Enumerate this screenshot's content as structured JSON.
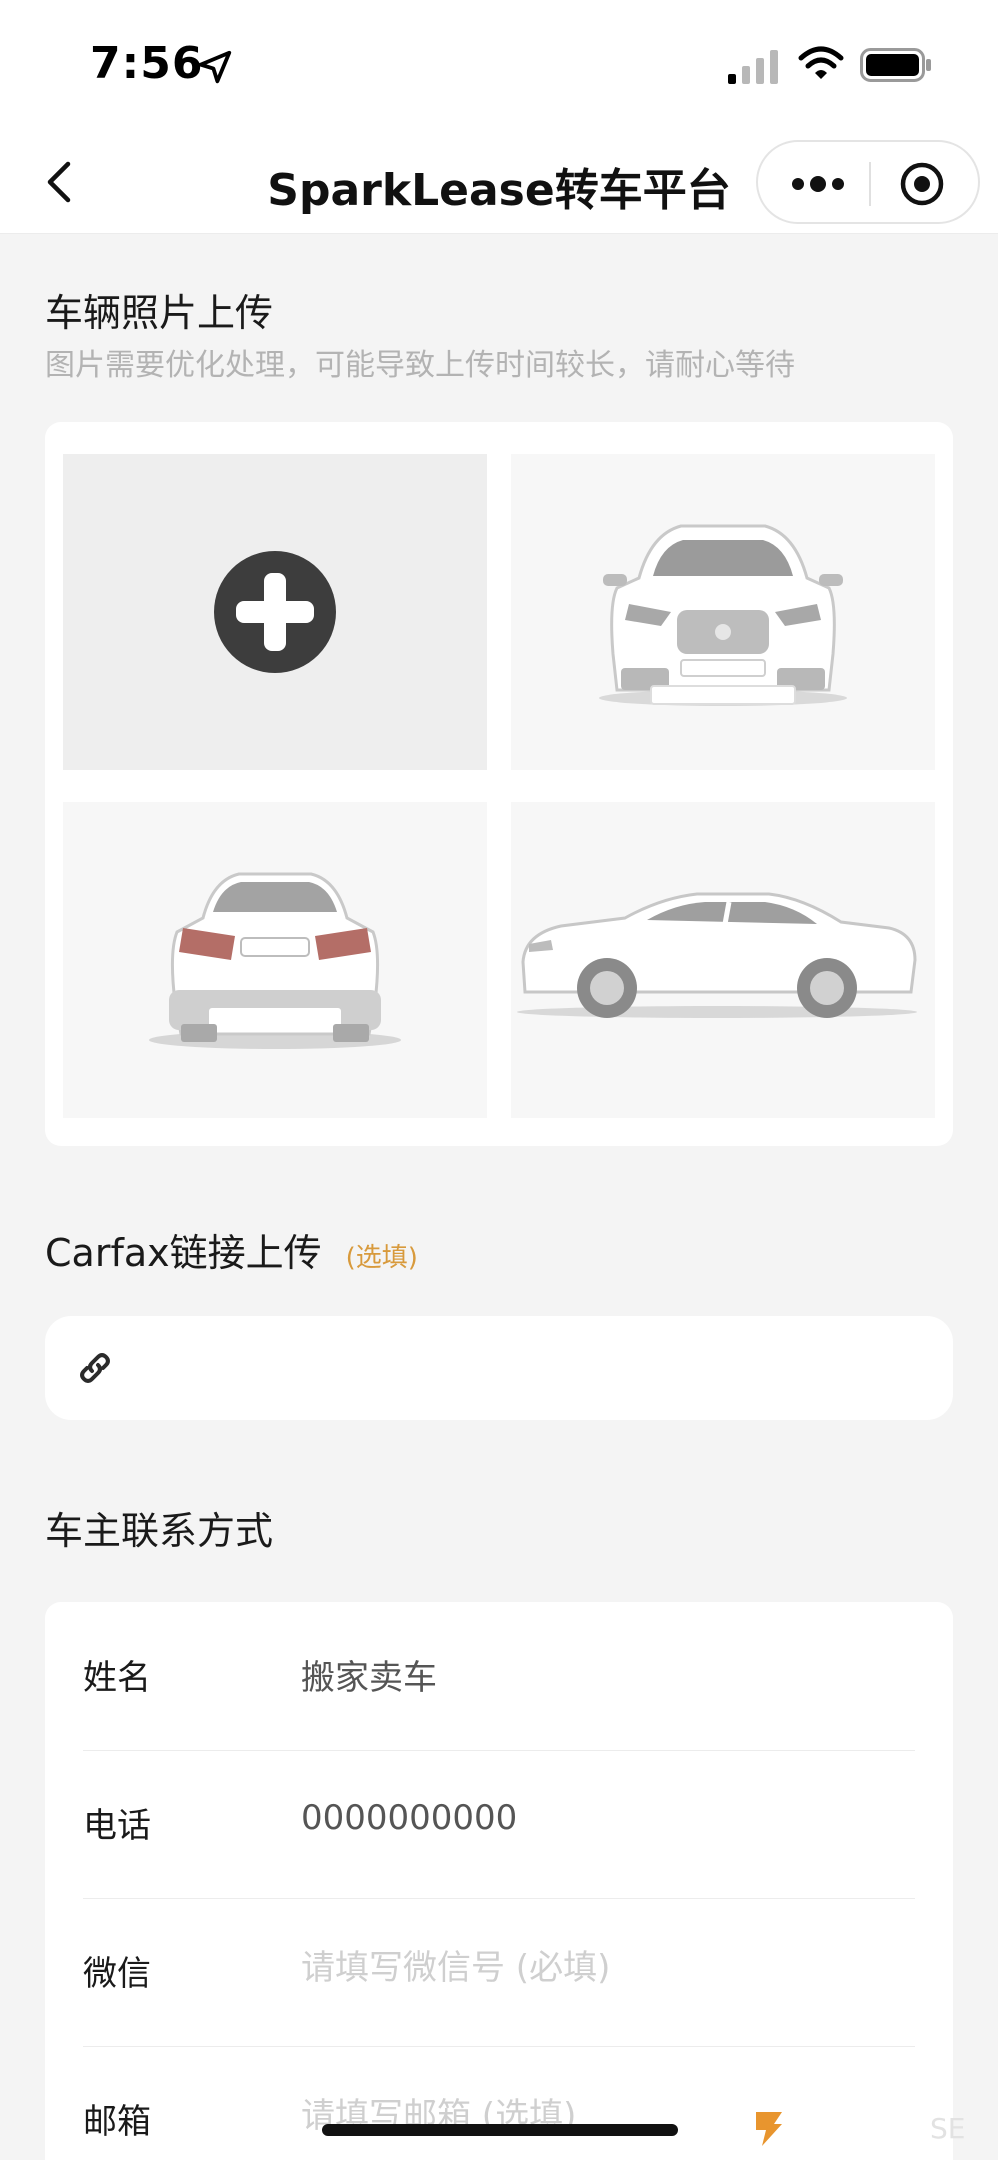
{
  "status_bar": {
    "time": "7:56",
    "icons": [
      "location-arrow-icon",
      "cellular-signal-icon",
      "wifi-icon",
      "battery-icon"
    ]
  },
  "nav": {
    "back_icon": "chevron-left-icon",
    "title": "SparkLease转车平台",
    "capsule_icons": [
      "more-dots-icon",
      "close-circle-icon"
    ]
  },
  "photos": {
    "title": "车辆照片上传",
    "subtitle": "图片需要优化处理，可能导致上传时间较长，请耐心等待",
    "tiles": [
      {
        "kind": "add",
        "icon": "plus-circle-icon"
      },
      {
        "kind": "sample",
        "view": "front"
      },
      {
        "kind": "sample",
        "view": "rear"
      },
      {
        "kind": "sample",
        "view": "side"
      }
    ]
  },
  "carfax": {
    "title": "Carfax链接上传",
    "optional": "(选填)",
    "icon": "link-icon",
    "value": ""
  },
  "contact": {
    "title": "车主联系方式",
    "fields": {
      "name": {
        "label": "姓名",
        "value": "搬家卖车"
      },
      "phone": {
        "label": "电话",
        "value": "0000000000"
      },
      "wechat": {
        "label": "微信",
        "value": "",
        "placeholder": "请填写微信号 (必填)"
      },
      "email": {
        "label": "邮箱",
        "value": "",
        "placeholder": "请填写邮箱 (选填)"
      }
    }
  },
  "watermark_text": "SE",
  "colors": {
    "accent_orange": "#d89a3c",
    "background": "#f4f4f4",
    "card": "#ffffff",
    "placeholder": "#cfcfcf"
  }
}
